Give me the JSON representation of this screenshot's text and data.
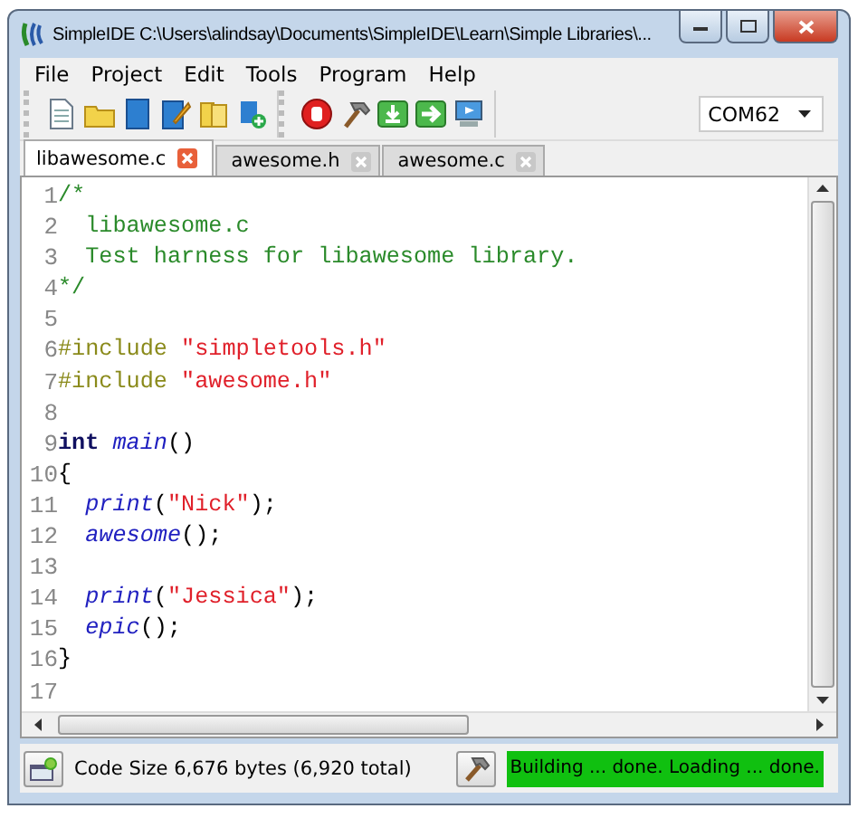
{
  "window": {
    "title": "SimpleIDE C:\\Users\\alindsay\\Documents\\SimpleIDE\\Learn\\Simple Libraries\\..."
  },
  "menu": [
    "File",
    "Project",
    "Edit",
    "Tools",
    "Program",
    "Help"
  ],
  "toolbar": {
    "port": "COM62"
  },
  "tabs": [
    {
      "label": "libawesome.c",
      "selected": true
    },
    {
      "label": "awesome.h",
      "selected": false
    },
    {
      "label": "awesome.c",
      "selected": false
    }
  ],
  "editor": {
    "lines": [
      {
        "number": "1",
        "tokens": [
          {
            "kind": "comment",
            "text": "/*"
          }
        ]
      },
      {
        "number": "2",
        "tokens": [
          {
            "kind": "comment",
            "text": "  libawesome.c"
          }
        ]
      },
      {
        "number": "3",
        "tokens": [
          {
            "kind": "comment",
            "text": "  Test harness for libawesome library."
          }
        ]
      },
      {
        "number": "4",
        "tokens": [
          {
            "kind": "comment",
            "text": "*/"
          }
        ]
      },
      {
        "number": "5"
      },
      {
        "number": "6",
        "tokens": [
          {
            "kind": "preproc",
            "text": "#include"
          },
          {
            "kind": "string",
            "text": " \"simpletools.h\""
          }
        ]
      },
      {
        "number": "7",
        "tokens": [
          {
            "kind": "preproc",
            "text": "#include"
          },
          {
            "kind": "string",
            "text": " \"awesome.h\""
          }
        ]
      },
      {
        "number": "8"
      },
      {
        "number": "9",
        "tokens": [
          {
            "kind": "keyword",
            "text": "int"
          },
          {
            "kind": "function",
            "text": " main"
          },
          {
            "kind": "plain",
            "text": "()"
          }
        ]
      },
      {
        "number": "10",
        "tokens": [
          {
            "kind": "plain",
            "text": "{"
          }
        ]
      },
      {
        "number": "11",
        "tokens": [
          {
            "kind": "function",
            "text": "  print"
          },
          {
            "kind": "plain",
            "text": "("
          },
          {
            "kind": "string",
            "text": "\"Nick\""
          },
          {
            "kind": "plain",
            "text": ");"
          }
        ]
      },
      {
        "number": "12",
        "tokens": [
          {
            "kind": "function",
            "text": "  awesome"
          },
          {
            "kind": "plain",
            "text": "();"
          }
        ]
      },
      {
        "number": "13"
      },
      {
        "number": "14",
        "tokens": [
          {
            "kind": "function",
            "text": "  print"
          },
          {
            "kind": "plain",
            "text": "("
          },
          {
            "kind": "string",
            "text": "\"Jessica\""
          },
          {
            "kind": "plain",
            "text": ");"
          }
        ]
      },
      {
        "number": "15",
        "tokens": [
          {
            "kind": "function",
            "text": "  epic"
          },
          {
            "kind": "plain",
            "text": "();"
          }
        ]
      },
      {
        "number": "16",
        "tokens": [
          {
            "kind": "plain",
            "text": "}"
          }
        ]
      },
      {
        "number": "17"
      }
    ]
  },
  "status_bar": {
    "code_size": "Code Size 6,676 bytes (6,920 total)",
    "message": "Building ... done. Loading ...  done."
  }
}
